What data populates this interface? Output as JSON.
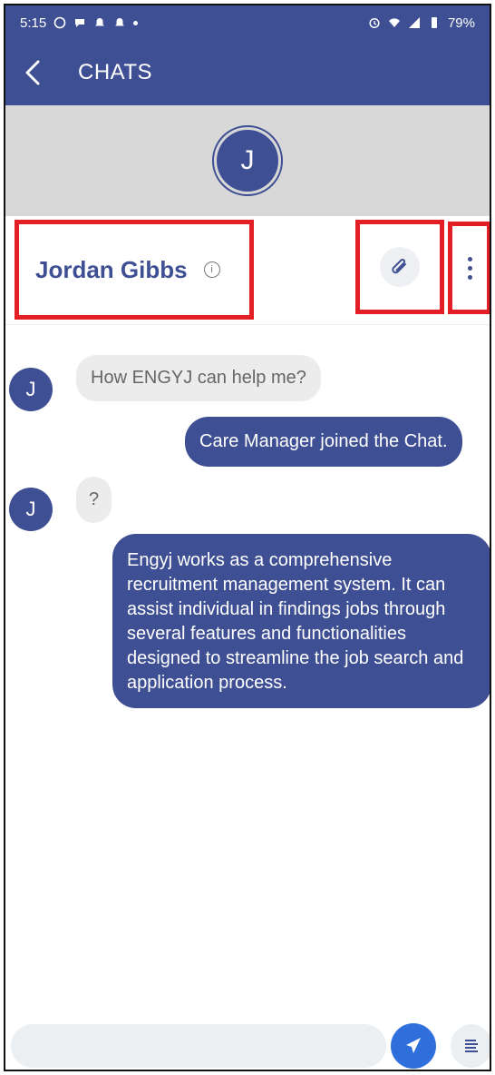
{
  "status_bar": {
    "time": "5:15",
    "battery": "79%"
  },
  "app_bar": {
    "title": "CHATS"
  },
  "contact": {
    "initial": "J",
    "name": "Jordan Gibbs"
  },
  "messages": [
    {
      "direction": "in",
      "avatar": "J",
      "text": "How ENGYJ can help me?"
    },
    {
      "direction": "out",
      "text": "Care Manager joined the Chat."
    },
    {
      "direction": "in",
      "avatar": "J",
      "text": "?"
    },
    {
      "direction": "out",
      "text": "Engyj works as a comprehensive recruitment management system. It can assist individual in findings jobs through several features and functionalities designed to streamline the job search and application process."
    }
  ],
  "colors": {
    "primary": "#3f4f93",
    "highlight_border": "#e31e24",
    "send_button": "#2f6fdb",
    "incoming_bubble": "#ececec"
  }
}
